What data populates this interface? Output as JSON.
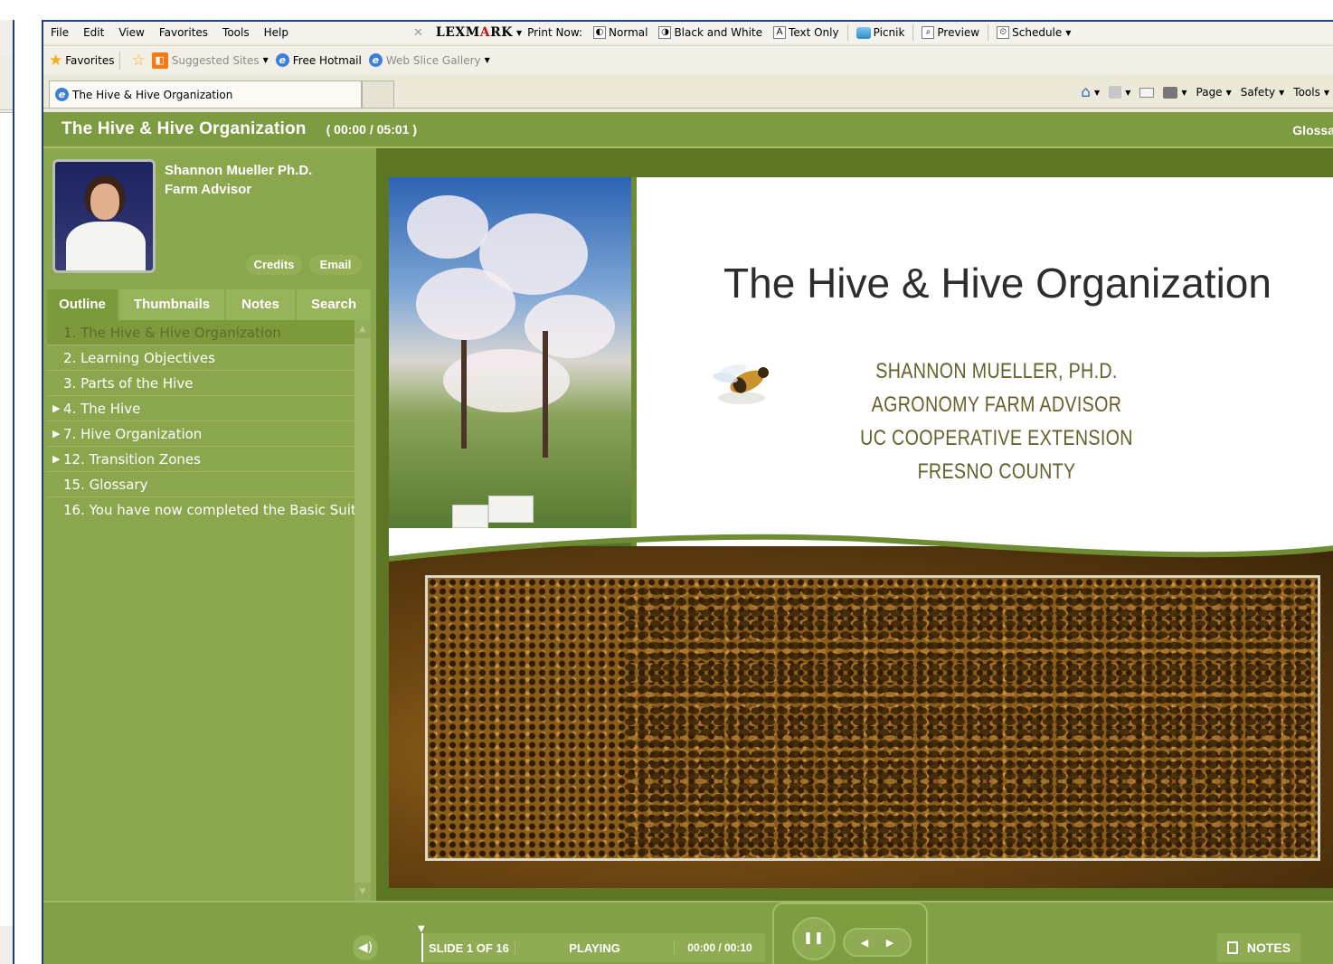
{
  "browser": {
    "menu": [
      "File",
      "Edit",
      "View",
      "Favorites",
      "Tools",
      "Help"
    ],
    "toolbar": {
      "lexmark_pre": "LEXM",
      "lexmark_a": "A",
      "lexmark_post": "RK",
      "print_now": "Print Now:",
      "normal": "Normal",
      "black_white": "Black and White",
      "text_only": "Text Only",
      "picnik": "Picnik",
      "preview": "Preview",
      "schedule": "Schedule"
    },
    "favorites": {
      "favorites_label": "Favorites",
      "suggested_sites": "Suggested Sites",
      "free_hotmail": "Free Hotmail",
      "web_slice_gallery": "Web Slice Gallery"
    },
    "tab_title": "The Hive & Hive Organization",
    "command_bar": {
      "page": "Page",
      "safety": "Safety",
      "tools": "Tools"
    }
  },
  "player": {
    "title": "The Hive & Hive Organization",
    "time": "( 00:00 / 05:01 )",
    "glossary": "Glossa",
    "presenter": {
      "name": "Shannon Mueller Ph.D.",
      "title": "Farm Advisor"
    },
    "buttons": {
      "credits": "Credits",
      "email": "Email"
    },
    "tabs": [
      "Outline",
      "Thumbnails",
      "Notes",
      "Search"
    ],
    "outline": [
      {
        "label": "1. The Hive & Hive Organization",
        "expandable": false,
        "active": true
      },
      {
        "label": "2. Learning Objectives",
        "expandable": false,
        "active": false
      },
      {
        "label": "3. Parts of the Hive",
        "expandable": false,
        "active": false
      },
      {
        "label": "4. The Hive",
        "expandable": true,
        "active": false
      },
      {
        "label": "7. Hive Organization",
        "expandable": true,
        "active": false
      },
      {
        "label": "12. Transition Zones",
        "expandable": true,
        "active": false
      },
      {
        "label": "15. Glossary",
        "expandable": false,
        "active": false
      },
      {
        "label": "16. You have now completed the Basic Suit",
        "expandable": false,
        "active": false
      }
    ],
    "slide": {
      "title": "The Hive & Hive Organization",
      "lines": [
        "SHANNON MUELLER, PH.D.",
        "AGRONOMY FARM ADVISOR",
        "UC COOPERATIVE EXTENSION",
        "FRESNO COUNTY"
      ]
    },
    "status": {
      "slide": "SLIDE 1 OF 16",
      "state": "PLAYING",
      "time": "00:00 / 00:10"
    },
    "notes_label": "NOTES"
  }
}
